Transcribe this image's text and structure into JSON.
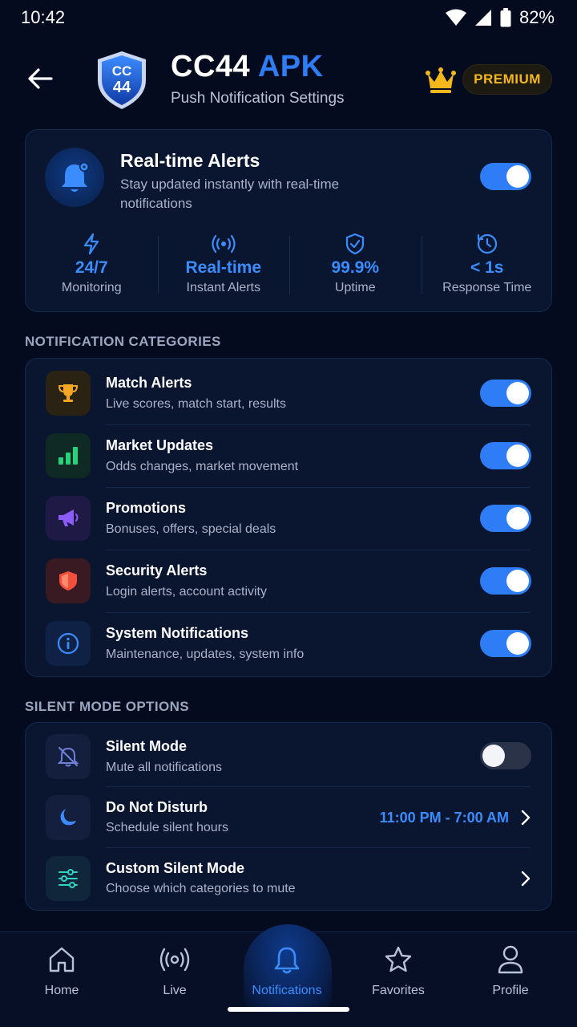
{
  "status_bar": {
    "time": "10:42",
    "battery": "82%"
  },
  "header": {
    "logo_text_top": "CC",
    "logo_text_bottom": "44",
    "title_main": "CC44",
    "title_accent": "APK",
    "subtitle": "Push Notification Settings",
    "badge": "PREMIUM"
  },
  "hero": {
    "title": "Real-time Alerts",
    "description": "Stay updated instantly with real-time notifications",
    "enabled": true,
    "stats": [
      {
        "icon": "lightning-icon",
        "value": "24/7",
        "label": "Monitoring"
      },
      {
        "icon": "broadcast-icon",
        "value": "Real-time",
        "label": "Instant Alerts"
      },
      {
        "icon": "shield-check-icon",
        "value": "99.9%",
        "label": "Uptime"
      },
      {
        "icon": "clock-icon",
        "value": "< 1s",
        "label": "Response Time"
      }
    ]
  },
  "categories": {
    "heading": "NOTIFICATION CATEGORIES",
    "items": [
      {
        "icon": "trophy-icon",
        "title": "Match Alerts",
        "desc": "Live scores, match start, results",
        "enabled": true,
        "color": "#f5a623"
      },
      {
        "icon": "bar-chart-icon",
        "title": "Market Updates",
        "desc": "Odds changes, market movement",
        "enabled": true,
        "color": "#27d37a"
      },
      {
        "icon": "megaphone-icon",
        "title": "Promotions",
        "desc": "Bonuses, offers, special deals",
        "enabled": true,
        "color": "#8b5cf6"
      },
      {
        "icon": "shield-icon",
        "title": "Security Alerts",
        "desc": "Login alerts, account activity",
        "enabled": true,
        "color": "#f0503c"
      },
      {
        "icon": "info-icon",
        "title": "System Notifications",
        "desc": "Maintenance, updates, system info",
        "enabled": true,
        "color": "#3b8cff"
      }
    ]
  },
  "silent": {
    "heading": "SILENT MODE OPTIONS",
    "silent_mode": {
      "title": "Silent Mode",
      "desc": "Mute all notifications",
      "enabled": false
    },
    "dnd": {
      "title": "Do Not Disturb",
      "desc": "Schedule silent hours",
      "value": "11:00 PM - 7:00 AM"
    },
    "custom": {
      "title": "Custom Silent Mode",
      "desc": "Choose which categories to mute"
    }
  },
  "nav": [
    {
      "icon": "home-icon",
      "label": "Home"
    },
    {
      "icon": "live-icon",
      "label": "Live"
    },
    {
      "icon": "bell-icon",
      "label": "Notifications",
      "active": true
    },
    {
      "icon": "star-icon",
      "label": "Favorites"
    },
    {
      "icon": "profile-icon",
      "label": "Profile"
    }
  ],
  "colors": {
    "accent": "#2f7df6",
    "premium": "#f5b81c",
    "background": "#040b1f",
    "card": "#0a1630"
  }
}
